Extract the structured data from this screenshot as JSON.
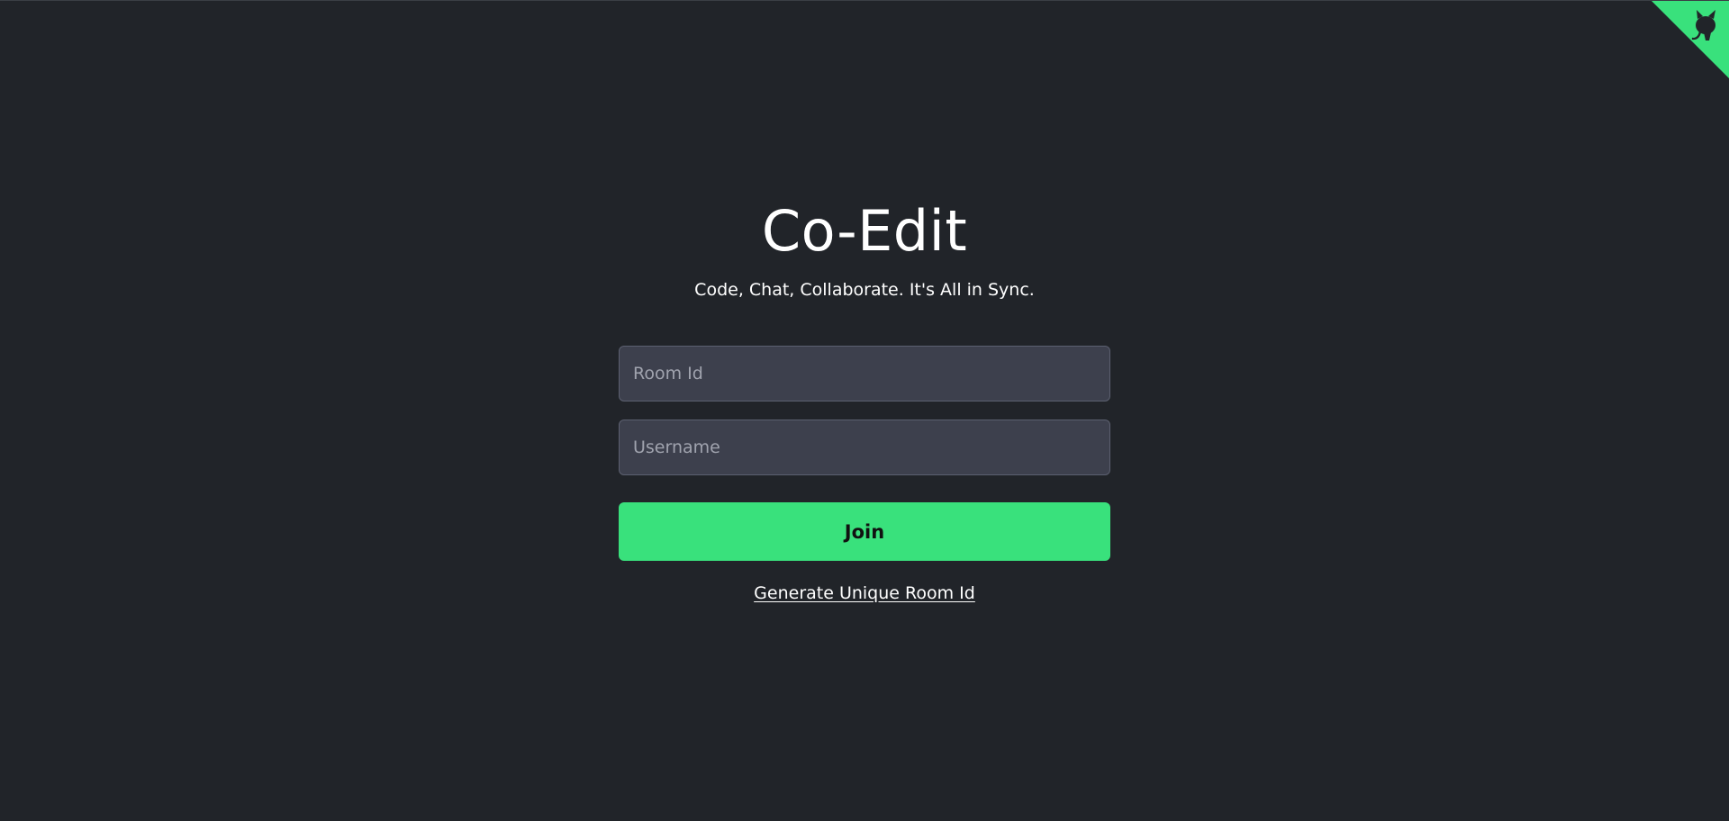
{
  "header": {
    "title": "Co-Edit",
    "subtitle": "Code, Chat, Collaborate. It's All in Sync."
  },
  "form": {
    "room_id": {
      "placeholder": "Room Id",
      "value": ""
    },
    "username": {
      "placeholder": "Username",
      "value": ""
    },
    "join_label": "Join",
    "generate_label": "Generate Unique Room Id"
  },
  "github_corner": {
    "icon": "github-octocat-icon",
    "color": "#39e17c",
    "icon_color": "#212429"
  },
  "colors": {
    "background": "#212429",
    "accent": "#39e17c",
    "input_bg": "#3d404d"
  }
}
